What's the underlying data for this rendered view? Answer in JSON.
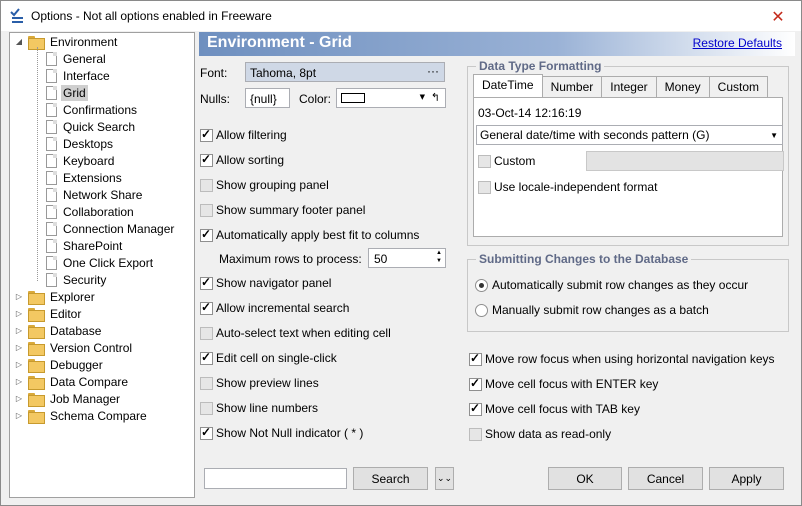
{
  "window": {
    "title": "Options - Not all options enabled in Freeware",
    "close_glyph": "✕"
  },
  "tree": {
    "root": "Environment",
    "children": [
      "General",
      "Interface",
      "Grid",
      "Confirmations",
      "Quick Search",
      "Desktops",
      "Keyboard",
      "Extensions",
      "Network Share",
      "Collaboration",
      "Connection Manager",
      "SharePoint",
      "One Click Export",
      "Security"
    ],
    "selected": "Grid",
    "folders": [
      "Explorer",
      "Editor",
      "Database",
      "Version Control",
      "Debugger",
      "Data Compare",
      "Job Manager",
      "Schema Compare"
    ]
  },
  "header": {
    "title": "Environment - Grid",
    "restore_link": "Restore Defaults"
  },
  "font": {
    "label": "Font:",
    "value": "Tahoma, 8pt",
    "browse": "···"
  },
  "nulls": {
    "label": "Nulls:",
    "value": "{null}"
  },
  "color": {
    "label": "Color:",
    "reset": "↰"
  },
  "left_options": [
    {
      "label": "Allow filtering",
      "checked": true
    },
    {
      "label": "Allow sorting",
      "checked": true
    },
    {
      "label": "Show grouping panel",
      "checked": false
    },
    {
      "label": "Show summary footer panel",
      "checked": false
    },
    {
      "label": "Automatically apply best fit to columns",
      "checked": true
    }
  ],
  "max_rows": {
    "label": "Maximum rows to process:",
    "value": "50"
  },
  "left_options2": [
    {
      "label": "Show navigator panel",
      "checked": true
    },
    {
      "label": "Allow incremental search",
      "checked": true
    },
    {
      "label": "Auto-select text when editing cell",
      "checked": false
    },
    {
      "label": "Edit cell on single-click",
      "checked": true
    },
    {
      "label": "Show preview lines",
      "checked": false
    },
    {
      "label": "Show line numbers",
      "checked": false
    },
    {
      "label": "Show Not Null indicator ( * )",
      "checked": true
    }
  ],
  "formatting": {
    "title": "Data Type Formatting",
    "tabs": [
      "DateTime",
      "Number",
      "Integer",
      "Money",
      "Custom"
    ],
    "active_tab": "DateTime",
    "preview": "03-Oct-14 12:16:19",
    "pattern": "General date/time with seconds pattern (G)",
    "custom_label": "Custom",
    "locale_label": "Use locale-independent format"
  },
  "submit": {
    "title": "Submitting Changes to the Database",
    "auto": "Automatically submit row changes as they occur",
    "manual": "Manually submit row changes as a batch"
  },
  "right_options": [
    {
      "label": "Move row focus when using horizontal navigation keys",
      "checked": true
    },
    {
      "label": "Move cell focus with ENTER key",
      "checked": true
    },
    {
      "label": "Move cell focus with TAB key",
      "checked": true
    },
    {
      "label": "Show data as read-only",
      "checked": false
    }
  ],
  "bottom": {
    "search_label": "Search",
    "ok": "OK",
    "cancel": "Cancel",
    "apply": "Apply",
    "down_glyph": "⌄⌄"
  }
}
